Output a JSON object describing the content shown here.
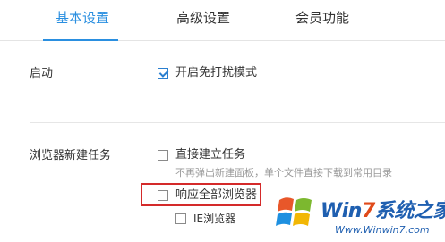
{
  "tabs": [
    {
      "label": "基本设置",
      "active": true
    },
    {
      "label": "高级设置",
      "active": false
    },
    {
      "label": "会员功能",
      "active": false
    }
  ],
  "startup": {
    "label": "启动",
    "options": [
      {
        "label": "开启免打扰模式",
        "checked": true
      }
    ]
  },
  "new_task": {
    "label": "浏览器新建任务",
    "direct_create": {
      "label": "直接建立任务",
      "checked": false
    },
    "hint": "不再弹出新建面板，单个文件直接下载到常用目录",
    "respond_all": {
      "label": "响应全部浏览器",
      "checked": false
    },
    "ie_browser": {
      "label": "IE浏览器",
      "checked": false
    }
  },
  "watermark": {
    "brand_prefix": "Win",
    "brand_num": "7",
    "brand_suffix": "系统之家",
    "url": "Www.Winwin7.com"
  },
  "colors": {
    "accent": "#2a8fe0",
    "highlight_border": "#d42a2a"
  }
}
